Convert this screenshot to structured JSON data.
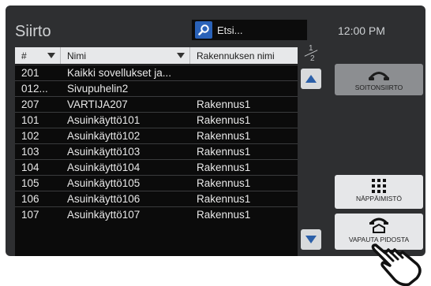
{
  "screen": {
    "title": "Siirto",
    "search_placeholder": "Etsi...",
    "clock": "12:00 PM"
  },
  "table": {
    "headers": [
      "#",
      "Nimi",
      "Rakennuksen nimi"
    ],
    "rows": [
      [
        "201",
        "Kaikki sovellukset ja...",
        ""
      ],
      [
        "012...",
        "Sivupuhelin2",
        ""
      ],
      [
        "207",
        "VARTIJA207",
        "Rakennus1"
      ],
      [
        "101",
        "Asuinkäyttö101",
        "Rakennus1"
      ],
      [
        "102",
        "Asuinkäyttö102",
        "Rakennus1"
      ],
      [
        "103",
        "Asuinkäyttö103",
        "Rakennus1"
      ],
      [
        "104",
        "Asuinkäyttö104",
        "Rakennus1"
      ],
      [
        "105",
        "Asuinkäyttö105",
        "Rakennus1"
      ],
      [
        "106",
        "Asuinkäyttö106",
        "Rakennus1"
      ],
      [
        "107",
        "Asuinkäyttö107",
        "Rakennus1"
      ]
    ]
  },
  "pager": {
    "current": "1",
    "total": "2"
  },
  "buttons": {
    "soitonsiirto": "SOITONSIIRTO",
    "nappaimisto": "NÄPPÄIMISTÖ",
    "vapauta": "VAPAUTA PIDOSTA"
  },
  "icons": {
    "search": "magnifier-icon",
    "scroll_up": "triangle-up-icon",
    "scroll_down": "triangle-down-icon",
    "transfer": "handset-icon",
    "keypad": "keypad-icon",
    "hold_release": "handset-release-icon",
    "pointer": "pointing-hand-icon"
  },
  "colors": {
    "frame": "#2e2f31",
    "table_bg": "#0b0b0b",
    "header_bg": "#e7e8ea",
    "search_icon": "#2a62b8",
    "button_bg": "#e6e7e9",
    "disabled_button": "#8c8e91"
  }
}
